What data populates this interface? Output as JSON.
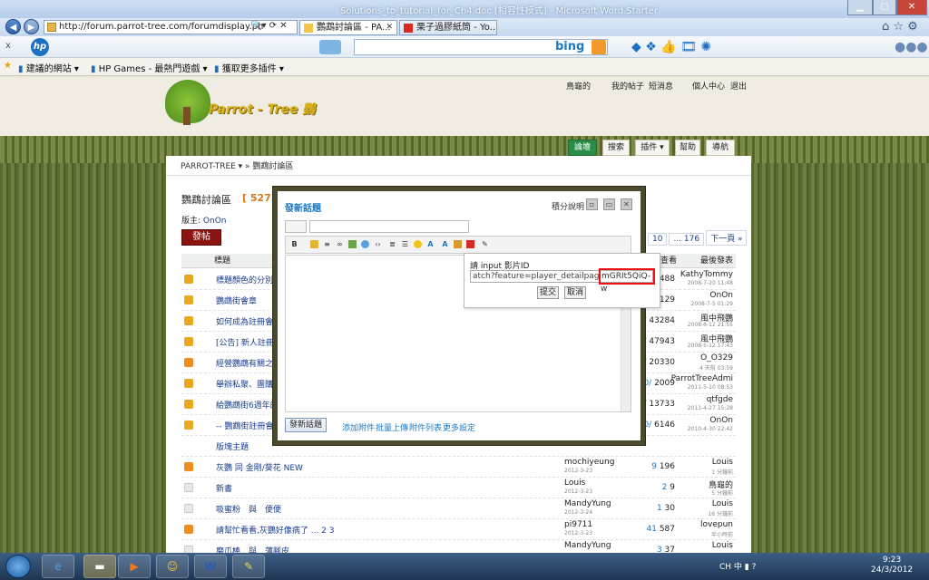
{
  "browser": {
    "window_title": "Solutions_to_tutorial_for_Ch4.doc [相容性模式] - Microsoft Word Starter",
    "url": "http://forum.parrot-tree.com/forumdisplay.ph",
    "tabs": [
      {
        "label": "鸚鵡討論區 - PA...",
        "active": true
      },
      {
        "label": "栗子過膠紙筒 - Yo...",
        "active": false
      }
    ],
    "search_engine": "bing",
    "favorites": [
      "建議的網站 ▾",
      "HP Games - 最熱門遊戲 ▾",
      "獲取更多插件 ▾"
    ]
  },
  "site": {
    "logo_text": "Parrot - Tree 鸚",
    "user_links": [
      "鳥龜的",
      "我的帖子",
      "短消息",
      "個人中心",
      "退出"
    ],
    "main_nav": [
      "論壇",
      "搜索",
      "插件 ▾",
      "幫助",
      "導航"
    ],
    "breadcrumb": "PARROT-TREE ▾ » 鸚鵡討論區"
  },
  "forum": {
    "title": "鸚鵡討論區",
    "count": "[ 5272",
    "moderator_label": "版主:",
    "moderator": "OnOn",
    "new_post_button": "發帖",
    "pager": [
      "10",
      "... 176",
      "下一頁 »"
    ],
    "columns": {
      "title": "標題",
      "views": "查看",
      "last": "最後發表"
    },
    "rows": [
      {
        "title": "標題顏色的分別",
        "author": "",
        "date": "",
        "replies": "",
        "views": "488",
        "last": "KathyTommy",
        "last_date": "2008-7-20 11:48",
        "icon": "lock"
      },
      {
        "title": "鸚鵡街會章",
        "author": "",
        "date": "",
        "replies": "",
        "views": "129",
        "last": "OnOn",
        "last_date": "2008-7-5 01:29",
        "icon": "lock"
      },
      {
        "title": "如何成為註冊會員",
        "author": "",
        "date": "",
        "replies": "/",
        "views": "43284",
        "last": "風中飛鸚",
        "last_date": "2008-6-12 21:55",
        "icon": "lock"
      },
      {
        "title": "[公告] 新人註冊,",
        "author": "",
        "date": "",
        "replies": "/",
        "views": "47943",
        "last": "風中飛鸚",
        "last_date": "2008-5-12 17:43",
        "icon": "lock"
      },
      {
        "title": "經營鸚鵡有關之職",
        "author": "",
        "date": "",
        "replies": "/",
        "views": "20330",
        "last": "O_O329",
        "last_date": "4 天前 03:59",
        "icon": "up"
      },
      {
        "title": "舉辦私聚、團購等",
        "author": "",
        "date": "",
        "replies": "0/",
        "views": "2009",
        "last": "ParrotTreeAdmi",
        "last_date": "2011-5-10 08:53",
        "icon": "lock"
      },
      {
        "title": "給鸚鵡街6週年的",
        "author": "",
        "date": "",
        "replies": "/",
        "views": "13733",
        "last": "qtfgde",
        "last_date": "2011-4-27 15:28",
        "icon": "lock"
      },
      {
        "title": "-- 鸚鵡街註冊會員",
        "author": "",
        "date": "",
        "replies": "0/",
        "views": "6146",
        "last": "OnOn",
        "last_date": "2010-4-30 22:42",
        "icon": "lock"
      },
      {
        "title": "版塊主題",
        "author": "",
        "date": "",
        "replies": "",
        "views": "",
        "last": "",
        "last_date": "",
        "icon": "none"
      },
      {
        "title": "灰鸚 同 金剛/葵花 NEW",
        "author": "mochiyeung",
        "date": "2012-3-23",
        "replies": "9",
        "views": "196",
        "last": "Louis",
        "last_date": "1 分鐘前",
        "icon": "orange"
      },
      {
        "title": "新書",
        "author": "Louis",
        "date": "2012-3-23",
        "replies": "2",
        "views": "9",
        "last": "鳥龜的",
        "last_date": "5 分鐘前",
        "icon": "doc"
      },
      {
        "title": "吸蜜粉　與　便便",
        "author": "MandyYung",
        "date": "2012-3-24",
        "replies": "1",
        "views": "30",
        "last": "Louis",
        "last_date": "16 分鐘前",
        "icon": "doc"
      },
      {
        "title": "請幫忙看看,灰鸚好像病了 ... 2 3",
        "author": "pi9711",
        "date": "2012-3-23",
        "replies": "41",
        "views": "587",
        "last": "lovepun",
        "last_date": "半小時前",
        "icon": "orange"
      },
      {
        "title": "磨爪棒　與　薄腳皮",
        "author": "MandyYung",
        "date": "",
        "replies": "3",
        "views": "37",
        "last": "Louis",
        "last_date": "",
        "icon": "doc"
      }
    ]
  },
  "modal": {
    "title": "發新話題",
    "help": "積分說明",
    "submit": "發新話題",
    "links": [
      "添加附件",
      "批量上傳",
      "附件列表",
      "更多設定"
    ]
  },
  "popup": {
    "label": "請 input 影片ID",
    "input_value": "atch?feature=player_detailpage&v=",
    "highlight_value": "mGRIt5QiQ-w",
    "submit": "提交",
    "cancel": "取消"
  },
  "taskbar": {
    "time": "9:23",
    "date": "24/3/2012",
    "tray": "CH 中 ▮ ?"
  }
}
